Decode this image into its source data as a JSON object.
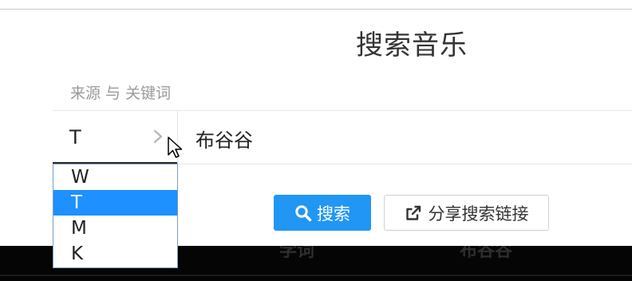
{
  "page": {
    "title": "搜索音乐",
    "source_keyword_label": "来源 与 关键词"
  },
  "source_select": {
    "selected": "T",
    "options": [
      "W",
      "T",
      "M",
      "K"
    ]
  },
  "keyword_input": {
    "value": "布谷谷"
  },
  "buttons": {
    "search_label": "搜索",
    "share_label": "分享搜索链接"
  },
  "bottom_bar": {
    "items": [
      "学词",
      "布谷谷"
    ]
  },
  "colors": {
    "accent": "#2196f3",
    "highlight": "#1e90ff"
  },
  "icons": [
    "chevron-right-icon",
    "search-icon",
    "external-link-icon",
    "mouse-cursor-icon"
  ]
}
